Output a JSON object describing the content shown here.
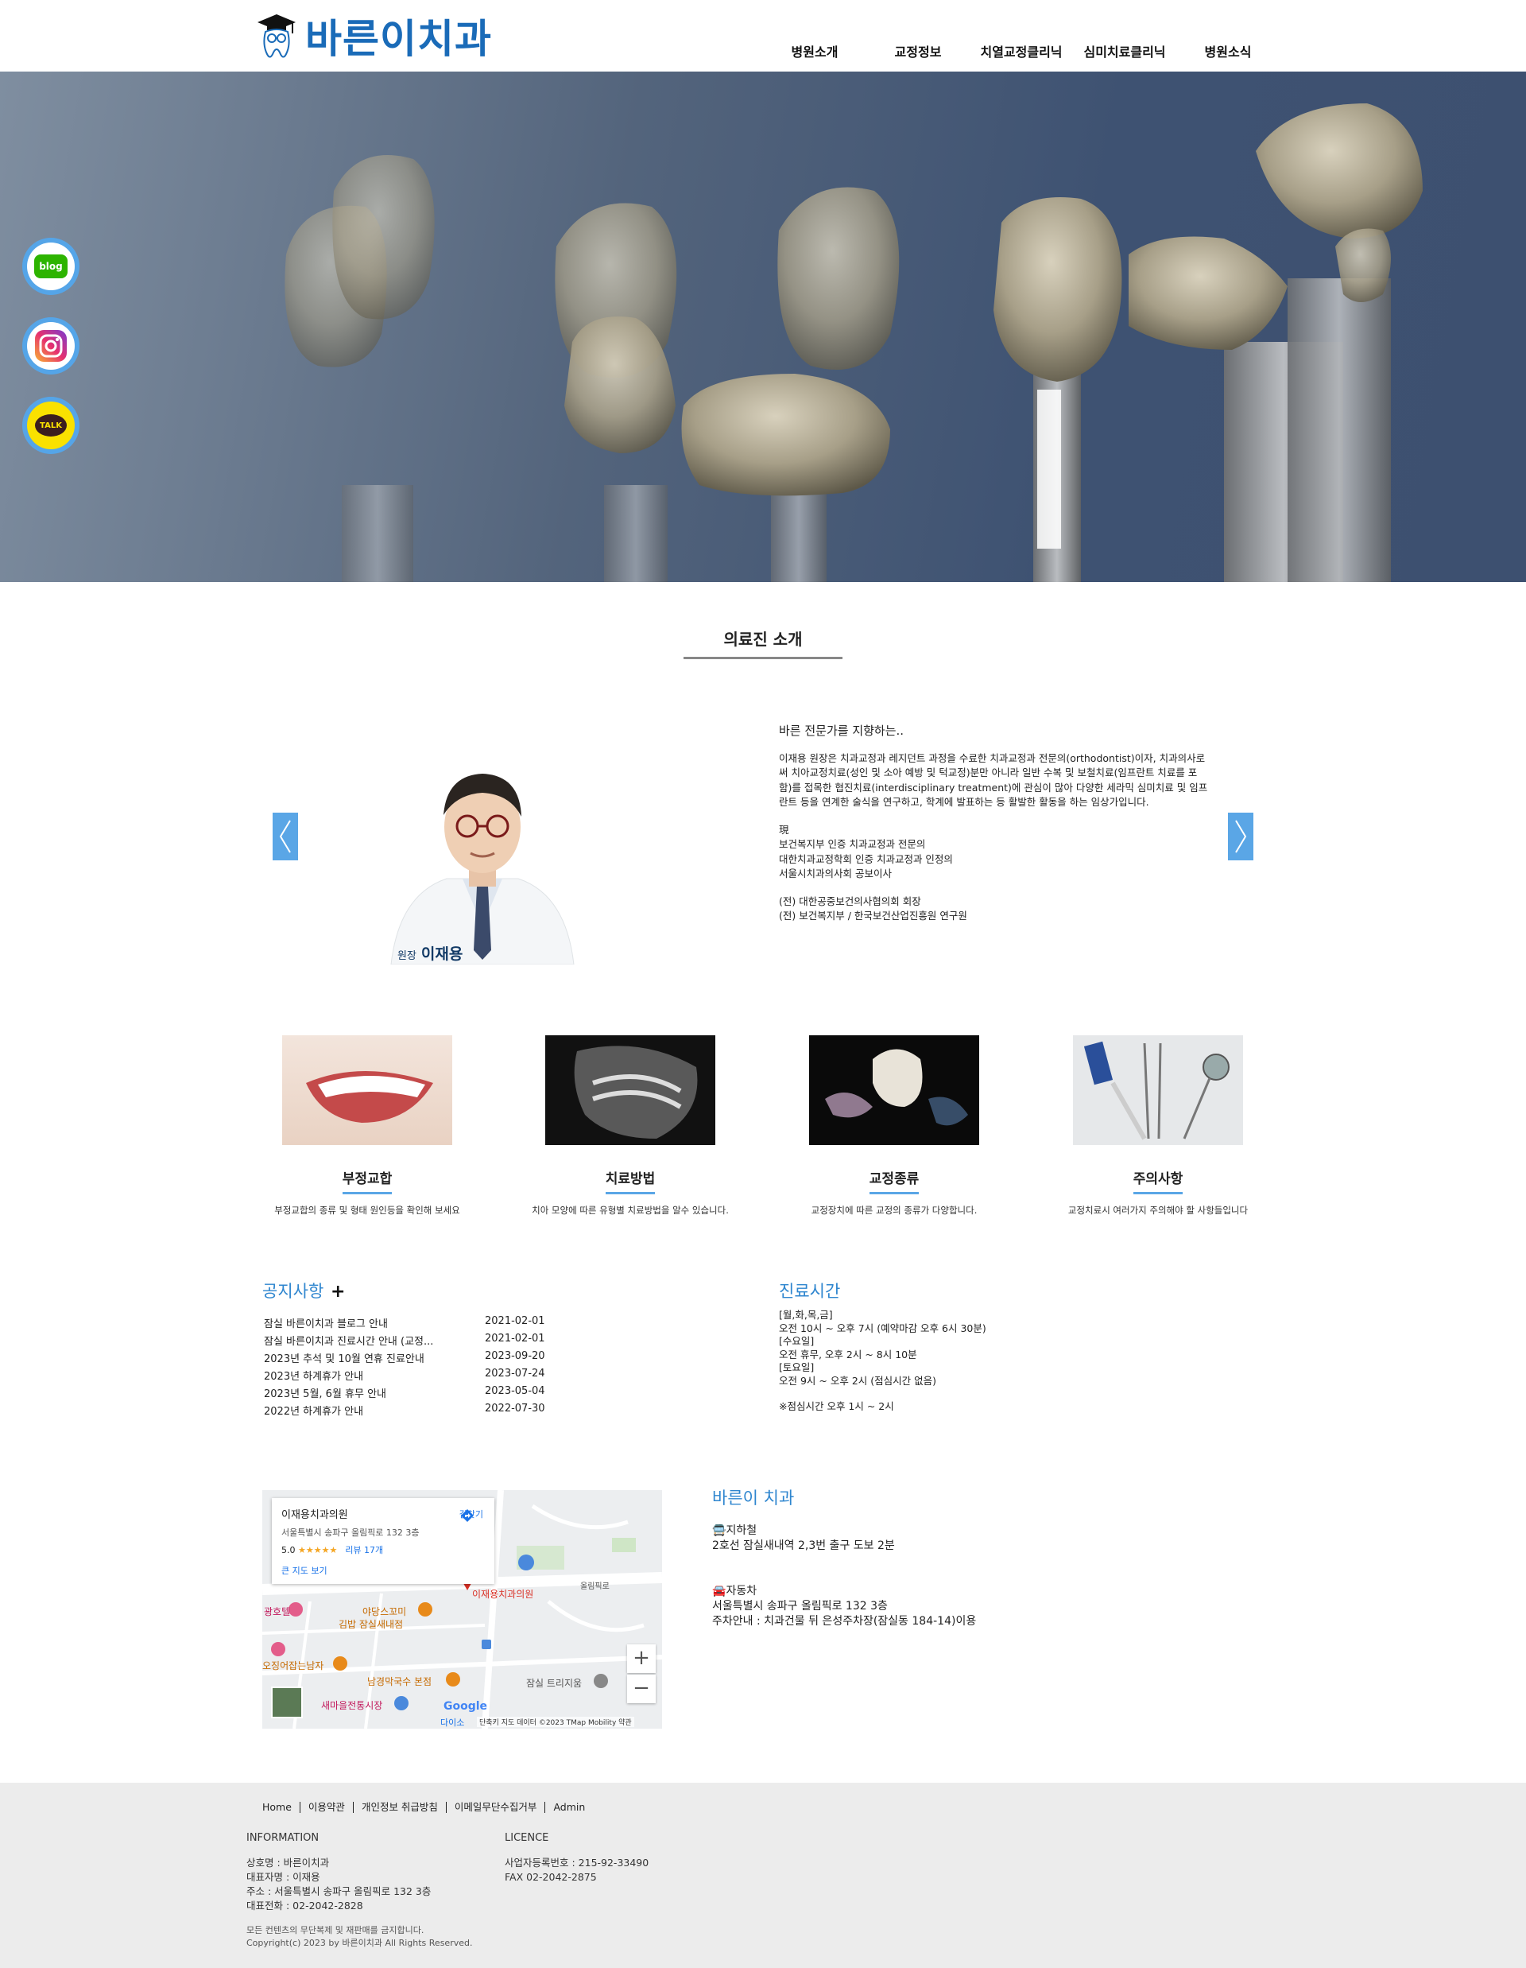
{
  "header": {
    "logo_text": "바른이치과",
    "nav": [
      "병원소개",
      "교정정보",
      "치열교정클리닉",
      "심미치료클리닉",
      "병원소식"
    ]
  },
  "social": {
    "blog": "blog",
    "instagram": "instagram-icon",
    "talk": "TALK"
  },
  "doctors": {
    "section_title": "의료진 소개",
    "name_prefix": "원장",
    "name": "이재용",
    "lead": "바른 전문가를 지향하는..",
    "intro": "이재용 원장은 치과교정과 레지던트 과정을 수료한 치과교정과 전문의(orthodontist)이자, 치과의사로써 치아교정치료(성인 및 소아 예방 및 턱교정)분만 아니라 일반 수복 및 보철치료(임프란트 치료를 포함)를 접목한 협진치료(interdisciplinary treatment)에 관심이 많아 다양한 세라믹 심미치료 및 임프란트 등을 연계한 술식을 연구하고, 학계에 발표하는 등 활발한 활동을 하는 임상가입니다.",
    "current_label": "現",
    "current": [
      "보건복지부 인증 치과교정과 전문의",
      "대한치과교정학회 인증 치과교정과 인정의",
      "서울시치과의사회 공보이사"
    ],
    "former": [
      "(전) 대한공중보건의사협의회 회장",
      "(전) 보건복지부 / 한국보건산업진흥원 연구원"
    ]
  },
  "cards": [
    {
      "title": "부정교합",
      "desc": "부정교합의 종류 및 형태 원인등을 확인해 보세요"
    },
    {
      "title": "치료방법",
      "desc": "치아 모양에 따른 유형별 치료방법을 알수 있습니다."
    },
    {
      "title": "교정종류",
      "desc": "교정장치에 따른 교정의 종류가 다양합니다."
    },
    {
      "title": "주의사항",
      "desc": "교정치료시 여러가지 주의해야 할 사항들입니다"
    }
  ],
  "notice": {
    "title": "공지사항",
    "plus": "+",
    "items": [
      {
        "title": "잠실 바른이치과 블로그 안내",
        "date": "2021-02-01"
      },
      {
        "title": "잠실 바른이치과 진료시간 안내 (교정...",
        "date": "2021-02-01"
      },
      {
        "title": "2023년 추석 및 10월 연휴 진료안내",
        "date": "2023-09-20"
      },
      {
        "title": "2023년 하계휴가 안내",
        "date": "2023-07-24"
      },
      {
        "title": "2023년 5월, 6월 휴무 안내",
        "date": "2023-05-04"
      },
      {
        "title": "2022년 하계휴가 안내",
        "date": "2022-07-30"
      }
    ]
  },
  "hours": {
    "title": "진료시간",
    "lines": [
      "[월,화,목,금]",
      "오전 10시 ~ 오후 7시 (예약마감 오후 6시 30분)",
      "[수요일]",
      "오전 휴무, 오후 2시 ~ 8시 10분",
      "[토요일]",
      "오전 9시 ~ 오후 2시 (점심시간 없음)",
      "",
      "※점심시간 오후 1시 ~ 2시"
    ]
  },
  "map": {
    "place": "이재용치과의원",
    "address": "서울특별시 송파구 올림픽로 132 3층",
    "rating": "5.0",
    "stars": "★★★★★",
    "reviews": "리뷰 17개",
    "big_map": "큰 지도 보기",
    "directions": "길찾기",
    "pin_label": "이재용치과의원",
    "labels": [
      "광호텔",
      "야당스꼬미",
      "김밥 잠실새내점",
      "오징어잡는남자",
      "남경막국수 본점",
      "새마을전통시장",
      "잠실 트리지움",
      "올림픽로",
      "다이소"
    ],
    "google": "Google",
    "footer": "단축키   지도 데이터 ©2023 TMap Mobility   약관",
    "zoom_in": "+",
    "zoom_out": "−"
  },
  "location": {
    "title": "바른이 치과",
    "subway_label": "지하철",
    "subway": "2호선 잠실새내역 2,3번 출구 도보 2분",
    "car_label": "자동차",
    "address": "서울특별시 송파구 올림픽로 132 3층",
    "parking": "주차안내 : 치과건물 뒤 은성주차장(잠실동 184-14)이용"
  },
  "footer": {
    "links": [
      "Home",
      "이용약관",
      "개인정보 취급방침",
      "이메일무단수집거부",
      "Admin"
    ],
    "info_head": "INFORMATION",
    "info": [
      "상호명 : 바른이치과",
      "대표자명 : 이재용",
      "주소 : 서울특별시 송파구 올림픽로 132 3층",
      "대표전화 : 02-2042-2828"
    ],
    "licence_head": "LICENCE",
    "licence": [
      "사업자등록번호 : 215-92-33490",
      "FAX 02-2042-2875"
    ],
    "copy1": "모든 컨텐츠의 무단복제 및 재판매를 금지합니다.",
    "copy2": "Copyright(c) 2023 by 바른이치과 All Rights Reserved."
  },
  "colors": {
    "accent": "#2f86cf",
    "arrow": "#5aa6e6",
    "footer_bg": "#ececec"
  }
}
